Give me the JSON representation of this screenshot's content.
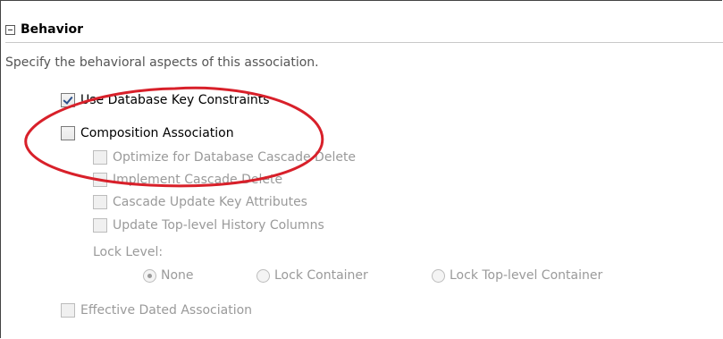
{
  "section": {
    "title": "Behavior",
    "toggle_icon": "collapse-minus-icon",
    "description": "Specify the behavioral aspects of this association."
  },
  "options": {
    "use_db_key_constraints": {
      "label": "Use Database Key Constraints",
      "checked": true,
      "enabled": true
    },
    "composition_association": {
      "label": "Composition Association",
      "checked": false,
      "enabled": true
    },
    "optimize_cascade_delete": {
      "label": "Optimize for Database Cascade Delete",
      "checked": false,
      "enabled": false
    },
    "implement_cascade_delete": {
      "label": "Implement Cascade Delete",
      "checked": false,
      "enabled": false
    },
    "cascade_update_key_attrs": {
      "label": "Cascade Update Key Attributes",
      "checked": false,
      "enabled": false
    },
    "update_top_level_history": {
      "label": "Update Top-level History Columns",
      "checked": false,
      "enabled": false
    },
    "effective_dated_association": {
      "label": "Effective Dated Association",
      "checked": false,
      "enabled": false
    }
  },
  "lock_level": {
    "label": "Lock Level:",
    "options": [
      "None",
      "Lock Container",
      "Lock Top-level Container"
    ],
    "selected": "None"
  },
  "annotation": {
    "shape": "ellipse-highlight",
    "color": "#d8202a"
  }
}
